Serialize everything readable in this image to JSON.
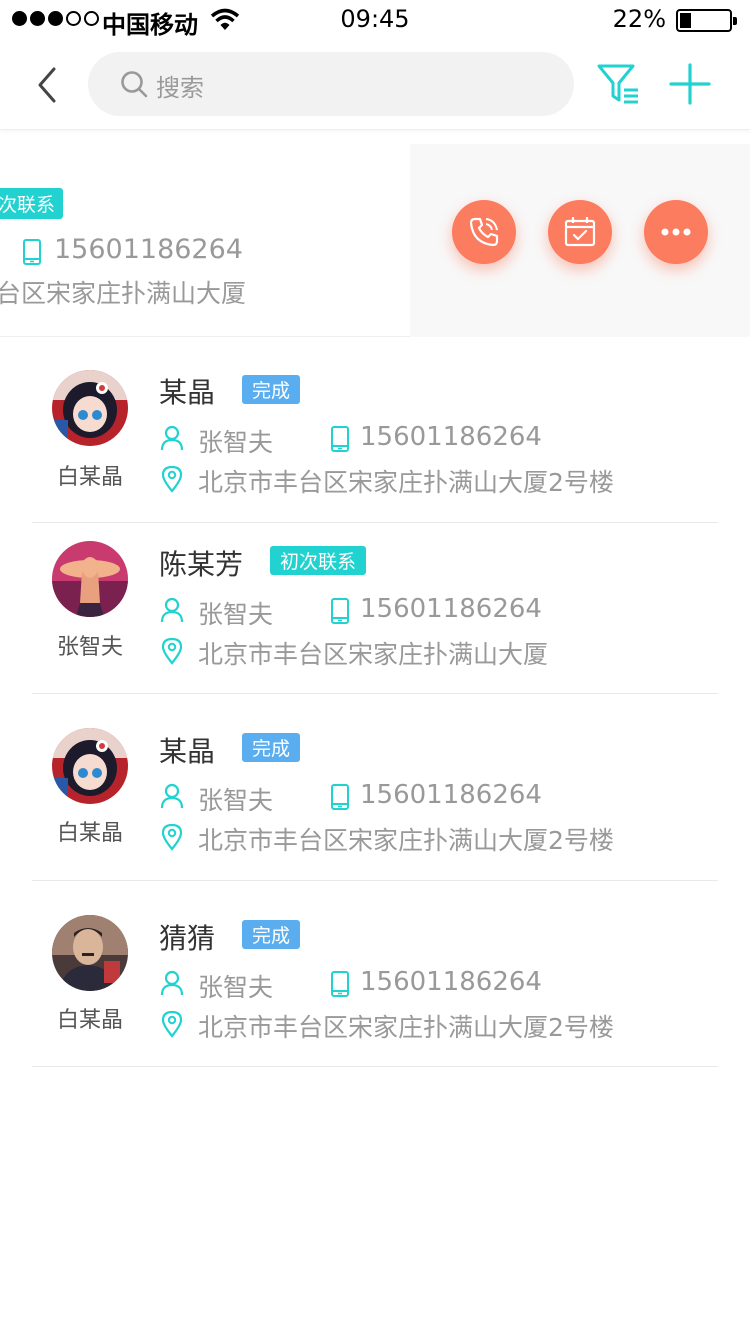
{
  "status_bar": {
    "signal_filled": 3,
    "signal_total": 5,
    "carrier": "中国移动",
    "time": "09:45",
    "battery_percent_label": "22%",
    "battery_level": 0.22
  },
  "nav": {
    "search_placeholder": "搜索",
    "icons": [
      "back-chevron-icon",
      "search-icon",
      "filter-icon",
      "plus-icon"
    ],
    "accent": "#21d2d0"
  },
  "swiped_item": {
    "tag": "次联系",
    "phone": "15601186264",
    "address": "台区宋家庄扑满山大厦",
    "actions": [
      "phone-call-icon",
      "calendar-check-icon",
      "more-dots-icon"
    ],
    "action_color": "#fb7c5f"
  },
  "contacts": [
    {
      "name": "某晶",
      "status": "完成",
      "status_color": "#5aaef0",
      "owner": "白某晶",
      "person": "张智夫",
      "phone": "15601186264",
      "address": "北京市丰台区宋家庄扑满山大厦2号楼"
    },
    {
      "name": "陈某芳",
      "status": "初次联系",
      "status_color": "#21d2d0",
      "owner": "张智夫",
      "person": "张智夫",
      "phone": "15601186264",
      "address": "北京市丰台区宋家庄扑满山大厦"
    },
    {
      "name": "某晶",
      "status": "完成",
      "status_color": "#5aaef0",
      "owner": "白某晶",
      "person": "张智夫",
      "phone": "15601186264",
      "address": "北京市丰台区宋家庄扑满山大厦2号楼"
    },
    {
      "name": "猜猜",
      "status": "完成",
      "status_color": "#5aaef0",
      "owner": "白某晶",
      "person": "张智夫",
      "phone": "15601186264",
      "address": "北京市丰台区宋家庄扑满山大厦2号楼"
    }
  ]
}
